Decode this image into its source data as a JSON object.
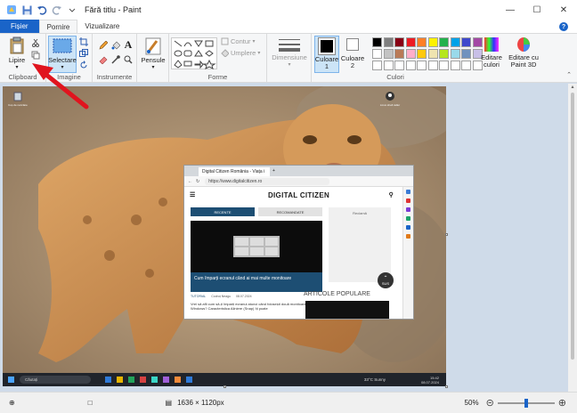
{
  "window": {
    "title": "Fără titlu - Paint",
    "minimize_icon": "minimize-icon",
    "maximize_icon": "maximize-icon",
    "close_icon": "close-icon"
  },
  "tabs": [
    {
      "label": "Fișier"
    },
    {
      "label": "Pornire"
    },
    {
      "label": "Vizualizare"
    }
  ],
  "ribbon": {
    "paste_label": "Lipire",
    "clipboard_label": "Clipboard",
    "select_label": "Selectare",
    "image_label": "Imagine",
    "tools_label": "Instrumente",
    "brushes_label": "Pensule",
    "contour_label": "Contur",
    "fill_label": "Umplere",
    "shapes_label": "Forme",
    "size_label": "Dimensiune",
    "color1_label": "Culoare 1",
    "color2_label": "Culoare 2",
    "edit_colors_label": "Editare culori",
    "edit_paint3d_label": "Editare cu Paint 3D",
    "colors_label": "Culori",
    "palette": [
      "#000000",
      "#7f7f7f",
      "#880015",
      "#ed1c24",
      "#ff7f27",
      "#fff200",
      "#22b14c",
      "#00a2e8",
      "#3f48cc",
      "#a349a4",
      "#ffffff",
      "#c3c3c3",
      "#b97a57",
      "#ffaec9",
      "#ffc90e",
      "#efe4b0",
      "#b5e61d",
      "#99d9ea",
      "#7092be",
      "#c8bfe7"
    ]
  },
  "desktop": {
    "icon1_label": "Coș de reciclare",
    "icon2_label": "Linux shell caller"
  },
  "browser": {
    "tab_title": "Digital Citizen România - Viața i",
    "url": "https://www.digitalcitizen.ro",
    "site_name": "DIGITAL CITIZEN",
    "tab_recent": "RECENTE",
    "tab_recommended": "RECOMANDATE",
    "ad_label": "Reclamă",
    "article_title": "Cum împarți ecranul când ai mai multe monitoare",
    "article_meta_tag": "TUTORIAL",
    "article_author": "Codruț Neagu",
    "article_date": "08.07.2024",
    "article_excerpt": "Vrei să afli cum să-ți împarți ecranul atunci când folosești două monitoare în Windows? Caracteristica Aliniere (Snap) îți poate",
    "popular_heading": "ARTICOLE POPULARE",
    "scroll_up_label": "SUS"
  },
  "image_taskbar": {
    "search_placeholder": "Căutați",
    "weather": "33°C  Sunny",
    "time": "15:42",
    "date": "08.07.2024"
  },
  "statusbar": {
    "dimensions": "1636 × 1120px",
    "zoom": "50%",
    "zoom_level": 0.5
  },
  "colors": {
    "accent": "#1a64c8",
    "arrow": "#e0141e",
    "canvas_bg": "#cfdbe9"
  }
}
